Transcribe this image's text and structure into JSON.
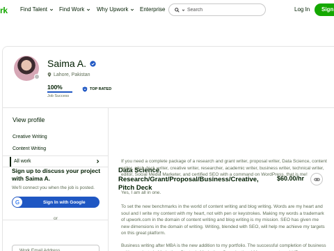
{
  "header": {
    "logo_text": "rk",
    "nav": [
      {
        "label": "Find Talent"
      },
      {
        "label": "Find Work"
      },
      {
        "label": "Why Upwork"
      },
      {
        "label": "Enterprise"
      }
    ],
    "search_placeholder": "Search",
    "login_label": "Log In",
    "signup_label": "Sign"
  },
  "profile": {
    "name": "Saima A.",
    "location": "Lahore, Pakistan",
    "job_success_pct": "100%",
    "job_success_value": 1.0,
    "job_success_label": "Job Success",
    "badge": "TOP RATED"
  },
  "sidebar": {
    "view_profile": "View profile",
    "items": [
      {
        "label": "Creative Writing"
      },
      {
        "label": "Content Writing"
      },
      {
        "label": "All work"
      }
    ],
    "signup_title": "Sign up to discuss your project with Saima A.",
    "signup_note": "We'll connect you when the job is posted.",
    "google_button": "Sign In with Google",
    "or_label": "or",
    "email_placeholder": "Work Email Address"
  },
  "job": {
    "title": "Data Science, Research/Grant/Proposal/Business/Creative, Pitch Deck",
    "rate": "$60.00/hr",
    "paragraphs": [
      "If you need a complete package of a research and grant writer, proposal writer, Data Science, content writer, pitch deck writer, creative writer, researcher, academic writer, business writer, technical writer, editor, Social Media Marketer, and certified SEO with a command on WordPress, that is me!",
      "Yes, I am all in one.",
      "To set the new benchmarks in the world of content writing and blog writing. Words are my heart and soul and I write my content with my heart, not with pen or keystrokes. Making my words a trademark of upwork.com in the domain of content writing and blog writing is my mission. SEO has given me new dimensions in the domain of writing. Writing, blended with SEO, will help me achieve my targets on this great platform.",
      "Business writing after MBA is the new addition to my portfolio. The successful completion of business writing projects in Marketing, Strategic Marketing, Organizational Management, and HR"
    ]
  },
  "colors": {
    "brand_green": "#14a800",
    "accent_blue": "#1f57c3",
    "text_dark": "#001e00",
    "text_muted": "#5e6d55"
  }
}
